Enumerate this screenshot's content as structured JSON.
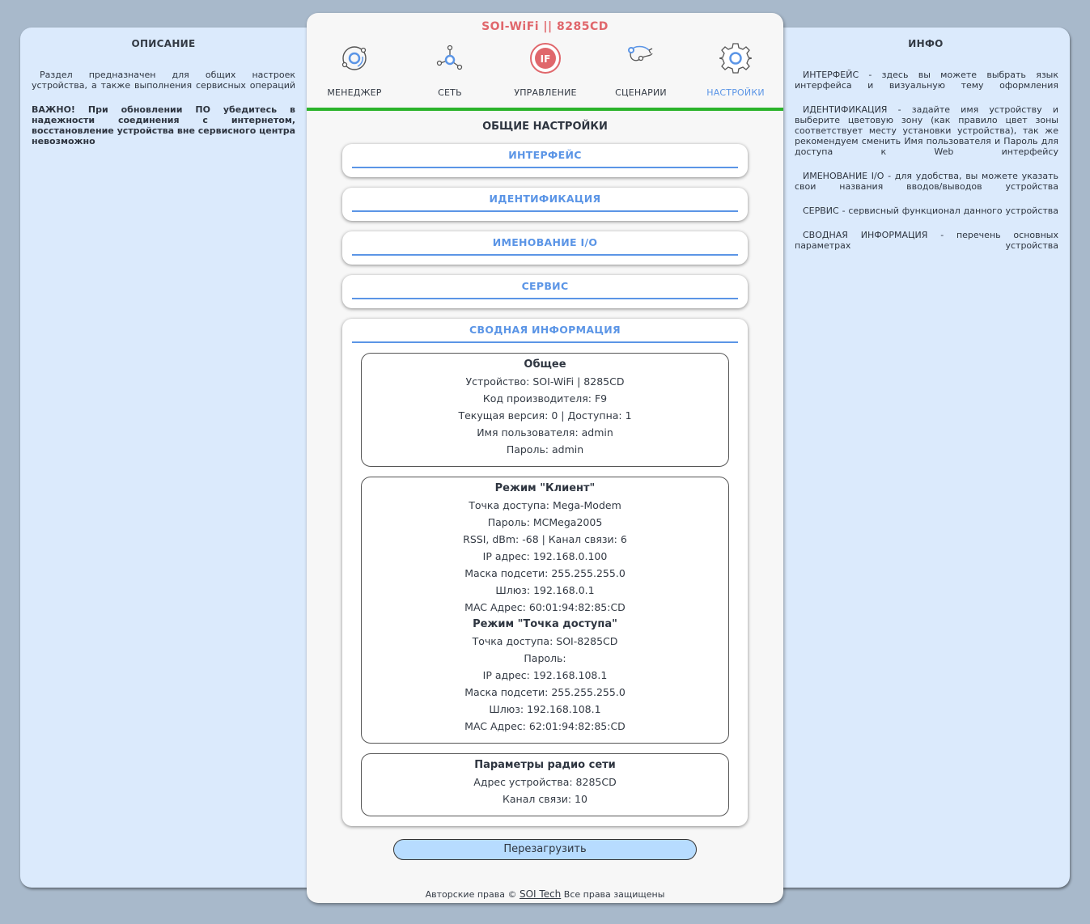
{
  "app_title": "SOI-WiFi || 8285CD",
  "left_panel": {
    "title": "ОПИСАНИЕ",
    "paragraphs": [
      "Раздел предназначен для общих настроек устройства, а также выполнения сервисных операций"
    ],
    "important": "ВАЖНО! При обновлении ПО убедитесь в надежности соединения с интернетом, восстановление устройства вне сервисного центра невозможно"
  },
  "right_panel": {
    "title": "ИНФО",
    "paragraphs": [
      "ИНТЕРФЕЙС - здесь вы можете выбрать язык интерфейса и визуальную тему оформления",
      "ИДЕНТИФИКАЦИЯ - задайте имя устройству и выберите цветовую зону (как правило цвет зоны соответствует месту установки устройства), так же рекомендуем сменить Имя пользователя и Пароль для доступа к Web интерфейсу",
      "ИМЕНОВАНИЕ I/O - для удобства, вы можете указать свои названия вводов/выводов устройства",
      "СЕРВИС - сервисный функционал данного устройства",
      "СВОДНАЯ ИНФОРМАЦИЯ - перечень основных параметрах устройства"
    ]
  },
  "nav": {
    "items": [
      {
        "label": "МЕНЕДЖЕР",
        "icon": "manager-icon"
      },
      {
        "label": "СЕТЬ",
        "icon": "network-icon"
      },
      {
        "label": "УПРАВЛЕНИЕ",
        "icon": "control-icon"
      },
      {
        "label": "СЦЕНАРИИ",
        "icon": "scenarios-icon"
      },
      {
        "label": "НАСТРОЙКИ",
        "icon": "gear-icon"
      }
    ],
    "active": "НАСТРОЙКИ",
    "control_icon_text": "IF"
  },
  "section_title": "ОБЩИЕ НАСТРОЙКИ",
  "accordions": {
    "interface": "ИНТЕРФЕЙС",
    "identification": "ИДЕНТИФИКАЦИЯ",
    "io_naming": "ИМЕНОВАНИЕ I/O",
    "service": "СЕРВИС",
    "summary": "СВОДНАЯ ИНФОРМАЦИЯ"
  },
  "summary": {
    "general": {
      "title": "Общее",
      "device": "Устройство: SOI-WiFi | 8285CD",
      "manufacturer_code": "Код производителя: F9",
      "version": "Текущая версия: 0 | Доступна: 1",
      "username": "Имя пользователя: admin",
      "password": "Пароль: admin"
    },
    "client": {
      "title": "Режим \"Клиент\"",
      "ssid": "Точка доступа: Mega-Modem",
      "password": "Пароль: MCMega2005",
      "rssi": "RSSI, dBm: -68 | Канал связи: 6",
      "ip": "IP адрес: 192.168.0.100",
      "mask": "Маска подсети: 255.255.255.0",
      "gateway": "Шлюз: 192.168.0.1",
      "mac": "MAC Адрес: 60:01:94:82:85:CD"
    },
    "ap": {
      "title": "Режим \"Точка доступа\"",
      "ssid": "Точка доступа: SOI-8285CD",
      "password": "Пароль:",
      "ip": "IP адрес: 192.168.108.1",
      "mask": "Маска подсети: 255.255.255.0",
      "gateway": "Шлюз: 192.168.108.1",
      "mac": "MAC Адрес: 62:01:94:82:85:CD"
    },
    "radio": {
      "title": "Параметры радио сети",
      "address": "Адрес устройства: 8285CD",
      "channel": "Канал связи: 10"
    }
  },
  "reboot_label": "Перезагрузить",
  "footer": {
    "prefix": "Авторские права ©",
    "link": "SOI Tech",
    "suffix": "Все права защищены"
  },
  "colors": {
    "background": "#a8b9cb",
    "side_panel": "#dbeafc",
    "accent": "#5b95e6",
    "title_red": "#e0676c",
    "green_bar": "#2bb32b",
    "button": "#b7dcff"
  }
}
